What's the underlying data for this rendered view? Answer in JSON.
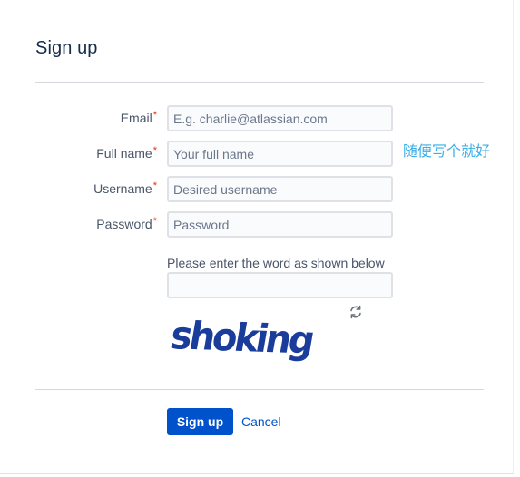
{
  "dialog": {
    "title": "Sign up"
  },
  "form": {
    "required_marker": "*",
    "email": {
      "label": "Email",
      "placeholder": "E.g. charlie@atlassian.com",
      "value": ""
    },
    "fullname": {
      "label": "Full name",
      "placeholder": "Your full name",
      "value": ""
    },
    "username": {
      "label": "Username",
      "placeholder": "Desired username",
      "value": ""
    },
    "password": {
      "label": "Password",
      "placeholder": "Password",
      "value": ""
    },
    "captcha": {
      "label": "Please enter the word as shown below",
      "value": "",
      "image_text": "shoking",
      "refresh_icon": "refresh-icon"
    }
  },
  "annotation": {
    "text": "随便写个就好"
  },
  "actions": {
    "submit_label": "Sign up",
    "cancel_label": "Cancel"
  },
  "colors": {
    "primary": "#0052cc",
    "required": "#de350b",
    "annotation": "#3aaee6",
    "captcha_text": "#1a3d9c"
  }
}
